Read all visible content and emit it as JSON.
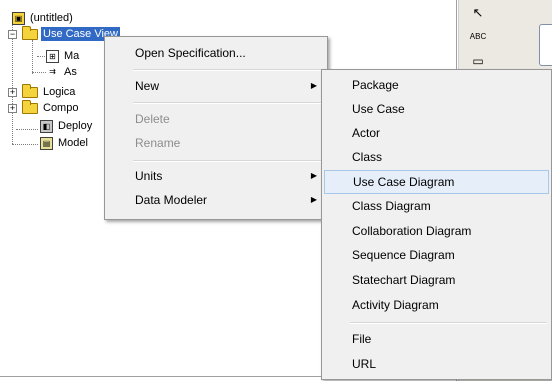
{
  "tree": {
    "root": "(untitled)",
    "items": [
      {
        "label": "Use Case View",
        "selected": true
      },
      {
        "label": "Ma"
      },
      {
        "label": "As"
      },
      {
        "label": "Logica"
      },
      {
        "label": "Compo"
      },
      {
        "label": "Deploy"
      },
      {
        "label": "Model"
      }
    ]
  },
  "toolbar": {
    "abc_label": "ABC"
  },
  "context_menu": {
    "items": [
      {
        "label": "Open Specification..."
      },
      {
        "label": "New"
      },
      {
        "label": "Delete",
        "disabled": true
      },
      {
        "label": "Rename",
        "disabled": true
      },
      {
        "label": "Units"
      },
      {
        "label": "Data Modeler"
      }
    ]
  },
  "submenu": {
    "items": [
      {
        "label": "Package"
      },
      {
        "label": "Use Case"
      },
      {
        "label": "Actor"
      },
      {
        "label": "Class"
      },
      {
        "label": "Use Case Diagram",
        "highlighted": true
      },
      {
        "label": "Class Diagram"
      },
      {
        "label": "Collaboration Diagram"
      },
      {
        "label": "Sequence Diagram"
      },
      {
        "label": "Statechart Diagram"
      },
      {
        "label": "Activity Diagram"
      },
      {
        "label": "File"
      },
      {
        "label": "URL"
      }
    ]
  },
  "colors": {
    "selection": "#316ac5",
    "menu_highlight": "#e5eef9",
    "folder": "#f5d33c"
  }
}
